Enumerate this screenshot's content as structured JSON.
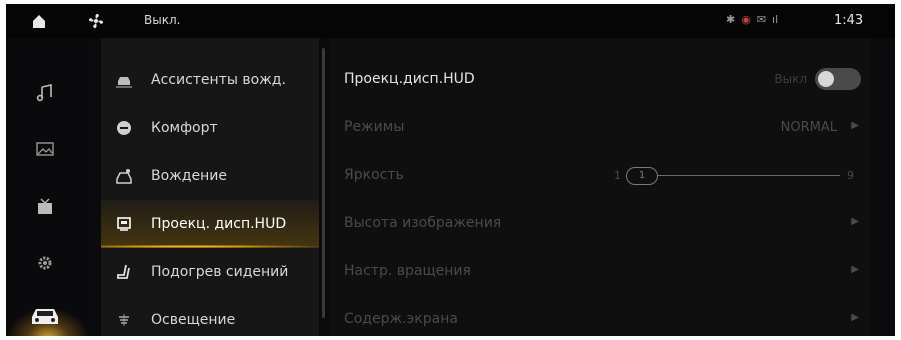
{
  "status_bar": {
    "fan_label": "Выкл.",
    "time": "1:43",
    "status_icons": [
      "bluetooth-icon",
      "badge-icon",
      "message-icon",
      "signal-icon"
    ]
  },
  "rail": {
    "items": [
      "music-icon",
      "gallery-icon",
      "video-icon",
      "gear-icon",
      "car-icon"
    ],
    "active": "car-icon"
  },
  "menu": {
    "items": [
      {
        "label": "Ассистенты вожд.",
        "icon": "driver-assist-icon"
      },
      {
        "label": "Комфорт",
        "icon": "comfort-icon"
      },
      {
        "label": "Вождение",
        "icon": "driving-icon"
      },
      {
        "label": "Проекц. дисп.HUD",
        "icon": "hud-icon"
      },
      {
        "label": "Подогрев сидений",
        "icon": "seat-heat-icon"
      },
      {
        "label": "Освещение",
        "icon": "lighting-icon"
      }
    ],
    "active_index": 3
  },
  "settings": {
    "hud": {
      "label": "Проекц.дисп.HUD",
      "toggle_label": "Выкл",
      "enabled": false
    },
    "modes": {
      "label": "Режимы",
      "value": "NORMAL"
    },
    "brightness": {
      "label": "Яркость",
      "min": "1",
      "max": "9",
      "value": "1"
    },
    "image_height": {
      "label": "Высота изображения"
    },
    "rotation": {
      "label": "Настр. вращения"
    },
    "screen_content": {
      "label": "Содерж.экрана"
    }
  },
  "colors": {
    "accent": "#f0b830",
    "background": "#0b0b0d",
    "panel": "#161617",
    "text_primary": "#e3e3e3",
    "text_disabled": "#4a4a4c"
  }
}
